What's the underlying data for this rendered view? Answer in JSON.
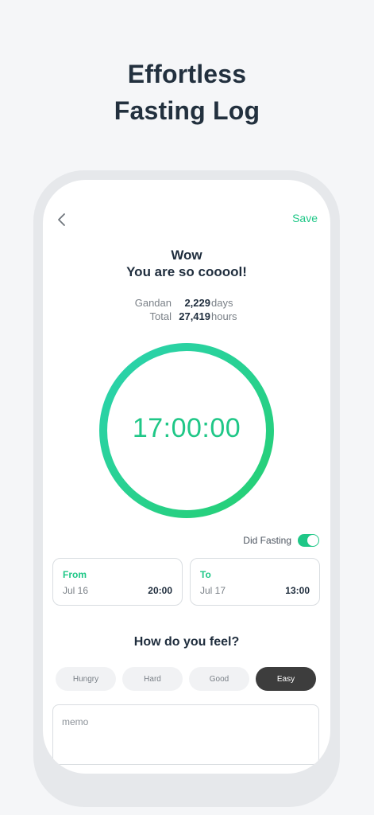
{
  "headline": {
    "line1": "Effortless",
    "line2": "Fasting Log"
  },
  "topbar": {
    "back_icon": "chevron-left-icon",
    "save_label": "Save"
  },
  "congrats": {
    "line1": "Wow",
    "line2": "You are so cooool!"
  },
  "stats": [
    {
      "label": "Gandan",
      "value": "2,229",
      "unit": "days"
    },
    {
      "label": "Total",
      "value": "27,419",
      "unit": "hours"
    }
  ],
  "timer": {
    "value": "17:00:00",
    "ring_color_start": "#2bd3b0",
    "ring_color_end": "#25cf72"
  },
  "fasting_toggle": {
    "label": "Did Fasting",
    "on": true
  },
  "time_cards": {
    "from": {
      "title": "From",
      "date": "Jul 16",
      "time": "20:00"
    },
    "to": {
      "title": "To",
      "date": "Jul 17",
      "time": "13:00"
    }
  },
  "feel": {
    "title": "How do you feel?",
    "options": [
      "Hungry",
      "Hard",
      "Good",
      "Easy"
    ],
    "selected": "Easy"
  },
  "memo": {
    "placeholder": "memo"
  },
  "colors": {
    "accent": "#1fc787",
    "dark_chip": "#3d3d3d",
    "page_bg": "#f5f6f8"
  }
}
